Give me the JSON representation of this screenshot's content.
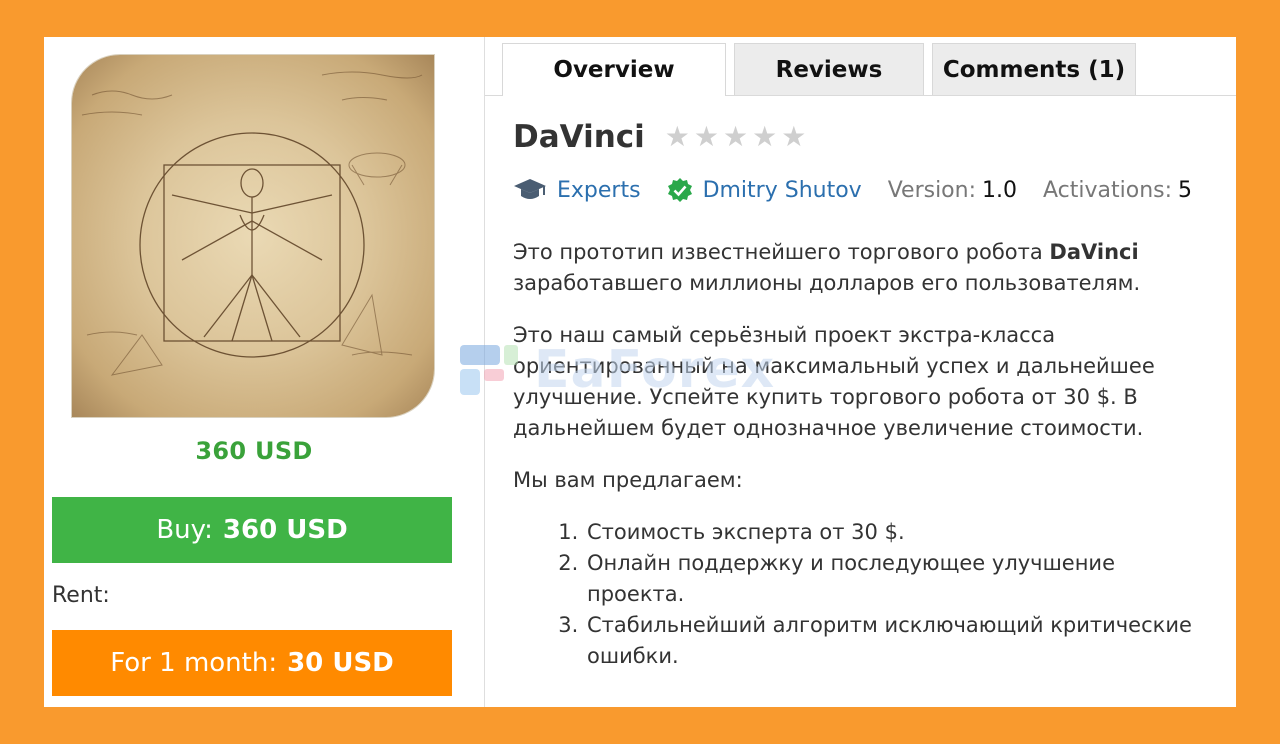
{
  "product": {
    "price_label": "360 USD",
    "buy_prefix": "Buy:",
    "buy_price": "360 USD",
    "rent_label": "Rent:",
    "rent_prefix": "For 1 month:",
    "rent_price": "30 USD",
    "image_icon": "vitruvian-man-illustration"
  },
  "tabs": [
    {
      "label": "Overview",
      "active": true
    },
    {
      "label": "Reviews",
      "active": false
    },
    {
      "label": "Comments (1)",
      "active": false
    }
  ],
  "header": {
    "title": "DaVinci",
    "rating": 0,
    "rating_max": 5
  },
  "meta": {
    "category": "Experts",
    "category_icon": "graduation-cap-icon",
    "author": "Dmitry Shutov",
    "author_icon": "verified-check-icon",
    "version_label": "Version:",
    "version_value": "1.0",
    "activations_label": "Activations:",
    "activations_value": "5"
  },
  "description": {
    "p1_before": "Это прототип известнейшего торгового робота ",
    "p1_bold": "DaVinci",
    "p1_after": " заработавшего миллионы долларов его пользователям.",
    "p2": "Это наш самый серьёзный проект экстра-класса ориентированный на максимальный успех и дальнейшее улучшение. Успейте купить торгового робота от 30 $. В дальнейшем будет однозначное увеличение стоимости.",
    "p3": "Мы вам предлагаем:",
    "list": [
      "Стоимость эксперта от 30 $.",
      "Онлайн поддержку и последующее улучшение проекта.",
      "Стабильнейший алгоритм исключающий критические ошибки."
    ]
  },
  "watermark": {
    "text": "EaForex"
  },
  "colors": {
    "background": "#f99a2e",
    "buy": "#40b446",
    "rent": "#ff8a00",
    "price": "#3aa23a",
    "link": "#2b6fae"
  }
}
